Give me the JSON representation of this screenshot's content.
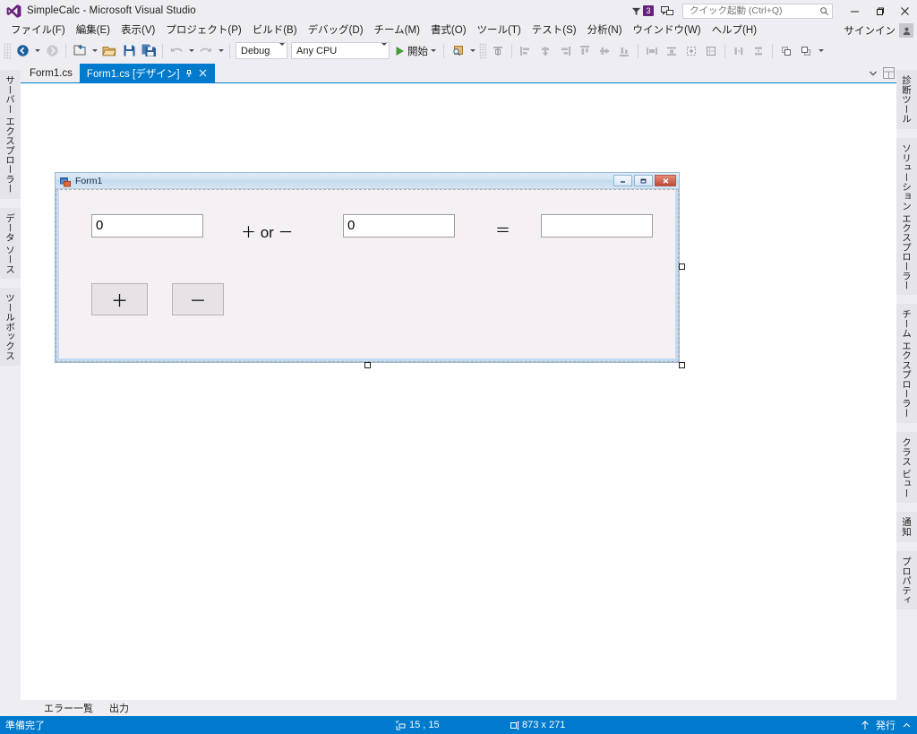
{
  "window": {
    "app_title": "SimpleCalc - Microsoft Visual Studio",
    "logo_icon": "visual-studio-logo",
    "minimize_icon": "minimize-icon",
    "restore_icon": "restore-icon",
    "close_icon": "close-icon",
    "feedback_icon": "feedback-icon",
    "notification_funnel_icon": "funnel-icon",
    "notification_count": "3"
  },
  "quick_launch": {
    "placeholder": "クイック起動 (Ctrl+Q)",
    "value": "",
    "search_icon": "magnifier-icon"
  },
  "menubar": {
    "items": [
      {
        "label": "ファイル(F)",
        "name": "menu-file"
      },
      {
        "label": "編集(E)",
        "name": "menu-edit"
      },
      {
        "label": "表示(V)",
        "name": "menu-view"
      },
      {
        "label": "プロジェクト(P)",
        "name": "menu-project"
      },
      {
        "label": "ビルド(B)",
        "name": "menu-build"
      },
      {
        "label": "デバッグ(D)",
        "name": "menu-debug"
      },
      {
        "label": "チーム(M)",
        "name": "menu-team"
      },
      {
        "label": "書式(O)",
        "name": "menu-format"
      },
      {
        "label": "ツール(T)",
        "name": "menu-tools"
      },
      {
        "label": "テスト(S)",
        "name": "menu-test"
      },
      {
        "label": "分析(N)",
        "name": "menu-analyze"
      },
      {
        "label": "ウインドウ(W)",
        "name": "menu-window"
      },
      {
        "label": "ヘルプ(H)",
        "name": "menu-help"
      }
    ],
    "signin_label": "サインイン",
    "signin_icon": "user-account-icon"
  },
  "toolbar": {
    "nav_back_icon": "navigate-back-icon",
    "nav_forward_icon": "navigate-forward-icon",
    "new_project_icon": "new-project-icon",
    "open_file_icon": "open-file-icon",
    "save_icon": "save-icon",
    "save_all_icon": "save-all-icon",
    "undo_icon": "undo-icon",
    "redo_icon": "redo-icon",
    "configuration": "Debug",
    "platform": "Any CPU",
    "start_label": "開始",
    "start_icon": "play-icon",
    "find_icon": "find-in-files-icon",
    "align_icons": [
      "align-to-grid-icon",
      "align-lefts-icon",
      "align-centers-icon",
      "align-rights-icon",
      "align-tops-icon",
      "align-middles-icon",
      "align-bottoms-icon",
      "make-same-width-icon",
      "make-same-height-icon",
      "make-same-size-icon",
      "size-to-grid-icon",
      "horizontal-spacing-icon",
      "vertical-spacing-icon",
      "bring-to-front-icon",
      "send-to-back-icon"
    ]
  },
  "left_rail": {
    "items": [
      {
        "label": "サーバー エクスプローラー",
        "name": "rail-server-explorer"
      },
      {
        "label": "データ ソース",
        "name": "rail-data-sources"
      },
      {
        "label": "ツールボックス",
        "name": "rail-toolbox"
      }
    ]
  },
  "right_rail": {
    "items": [
      {
        "label": "診断ツール",
        "name": "rail-diagnostic-tools"
      },
      {
        "label": "ソリューション エクスプローラー",
        "name": "rail-solution-explorer"
      },
      {
        "label": "チーム エクスプローラー",
        "name": "rail-team-explorer"
      },
      {
        "label": "クラス ビュー",
        "name": "rail-class-view"
      },
      {
        "label": "通知",
        "name": "rail-notifications"
      },
      {
        "label": "プロパティ",
        "name": "rail-properties"
      }
    ]
  },
  "tabs": {
    "items": [
      {
        "label": "Form1.cs",
        "active": false,
        "name": "tab-form1-cs"
      },
      {
        "label": "Form1.cs [デザイン]",
        "active": true,
        "name": "tab-form1-cs-design"
      }
    ],
    "pin_icon": "pin-icon",
    "close_icon": "close-tab-icon",
    "overflow_icon": "chevron-down-icon",
    "split_icon": "split-window-icon"
  },
  "designer": {
    "form": {
      "title": "Form1",
      "icon": "winform-icon",
      "minimize_icon": "form-minimize-icon",
      "maximize_icon": "form-maximize-icon",
      "close_icon": "form-close-icon",
      "controls": {
        "textbox1": {
          "value": "0",
          "name": "operand1-textbox"
        },
        "operator_label": {
          "text": "＋ or －",
          "name": "operator-label"
        },
        "textbox2": {
          "value": "0",
          "name": "operand2-textbox"
        },
        "equals_label": {
          "text": "＝",
          "name": "equals-label"
        },
        "result_textbox": {
          "value": "",
          "name": "result-textbox"
        },
        "plus_button": {
          "label": "＋",
          "name": "plus-button"
        },
        "minus_button": {
          "label": "－",
          "name": "minus-button"
        }
      }
    }
  },
  "bottom_tabs": {
    "items": [
      {
        "label": "エラー一覧",
        "name": "bottom-tab-error-list"
      },
      {
        "label": "出力",
        "name": "bottom-tab-output"
      }
    ]
  },
  "statusbar": {
    "ready_text": "準備完了",
    "position_icon": "position-icon",
    "position": "15 , 15",
    "size_icon": "size-icon",
    "size": "873 x 271",
    "publish_icon": "up-arrow-icon",
    "publish_label": "発行",
    "publish_caret_icon": "caret-up-icon"
  },
  "colors": {
    "accent": "#007acc",
    "chrome": "#eeeef2",
    "badge": "#68217a",
    "form_face": "#f4f0f4"
  }
}
